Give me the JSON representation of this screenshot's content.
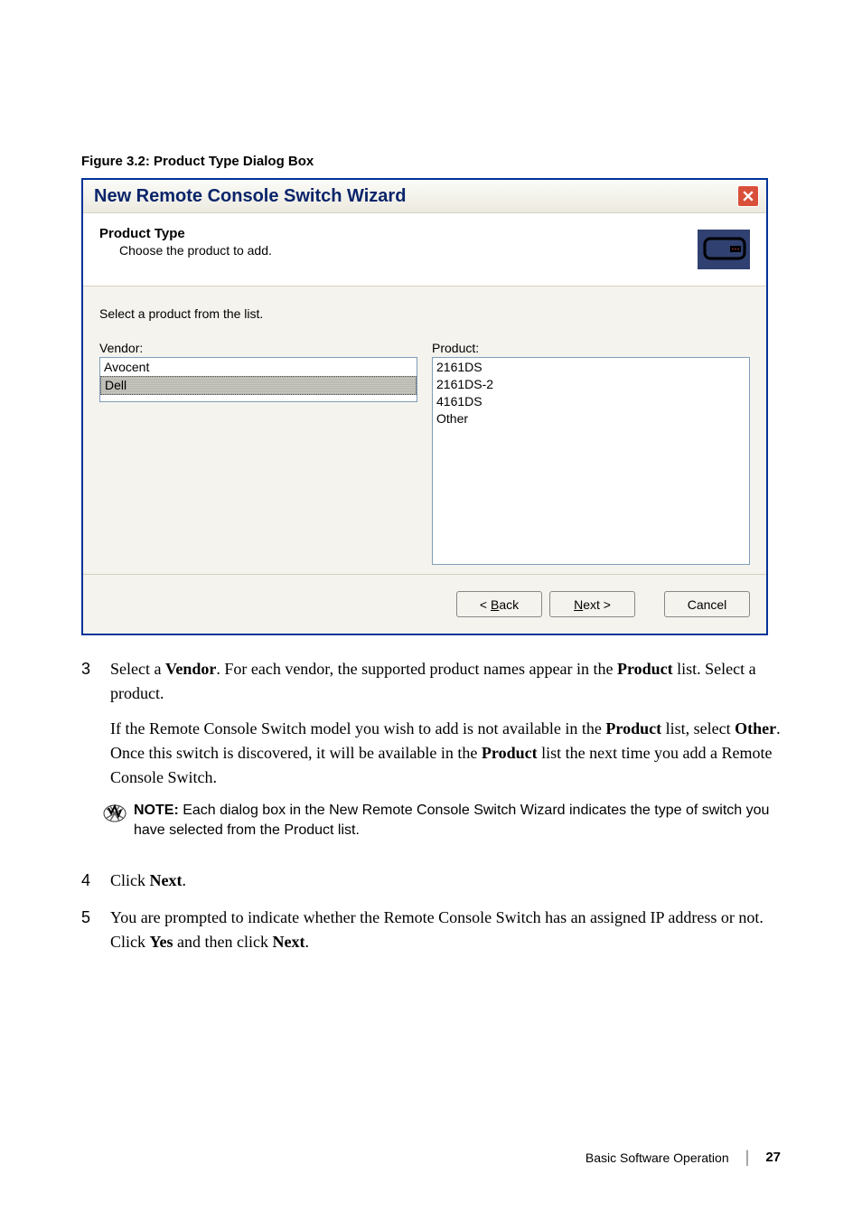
{
  "figure_caption": "Figure 3.2: Product Type Dialog Box",
  "dialog": {
    "title": "New Remote Console Switch Wizard",
    "header_title": "Product Type",
    "header_sub": "Choose the product to add.",
    "instruction": "Select a product from the list.",
    "vendor_label": "Vendor:",
    "product_label": "Product:",
    "vendors": [
      "Avocent",
      "Dell"
    ],
    "products": [
      "2161DS",
      "2161DS-2",
      "4161DS",
      "Other"
    ],
    "btn_back_pre": "< ",
    "btn_back_u": "B",
    "btn_back_post": "ack",
    "btn_next_u": "N",
    "btn_next_post": "ext >",
    "btn_cancel": "Cancel"
  },
  "steps": {
    "s3_num": "3",
    "s3_p1_a": "Select a ",
    "s3_p1_b": "Vendor",
    "s3_p1_c": ". For each vendor, the supported product names appear in the ",
    "s3_p1_d": "Product",
    "s3_p1_e": " list. Select a product.",
    "s3_p2_a": "If the Remote Console Switch model you wish to add is not available in the ",
    "s3_p2_b": "Product",
    "s3_p2_c": " list, select ",
    "s3_p2_d": "Other",
    "s3_p2_e": ". Once this switch is discovered, it will be available in the ",
    "s3_p2_f": "Product",
    "s3_p2_g": " list the next time you add a Remote Console Switch.",
    "note_label": "NOTE:",
    "note_text": " Each dialog box in the New Remote Console Switch Wizard indicates the type of switch you have selected from the Product list.",
    "s4_num": "4",
    "s4_a": "Click ",
    "s4_b": "Next",
    "s4_c": ".",
    "s5_num": "5",
    "s5_a": "You are prompted to indicate whether the Remote Console Switch has an assigned IP address or not. Click ",
    "s5_b": "Yes",
    "s5_c": " and then click ",
    "s5_d": "Next",
    "s5_e": "."
  },
  "footer": {
    "section": "Basic Software Operation",
    "page": "27"
  }
}
